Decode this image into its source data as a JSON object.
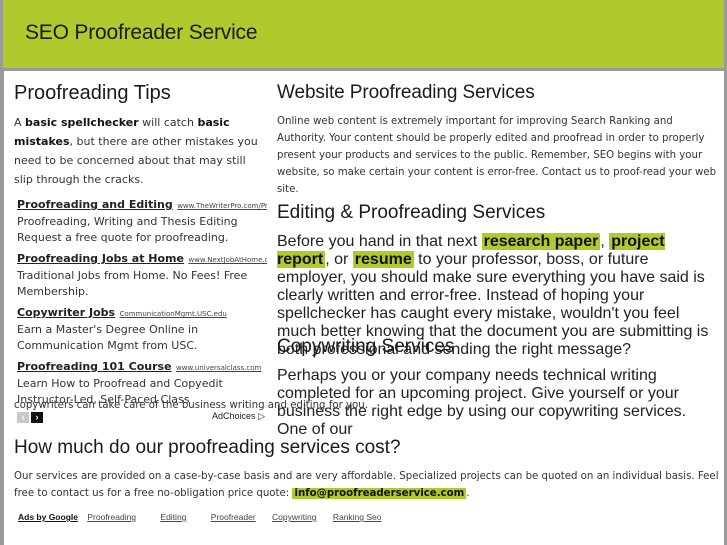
{
  "header": {
    "title": "SEO Proofreader Service"
  },
  "colors": {
    "accent": "#b0c92d",
    "frame": "#9a9a9a"
  },
  "sidebar": {
    "title": "Proofreading Tips",
    "intro": {
      "p1": "A ",
      "b1": "basic spellchecker",
      "p2": " will catch ",
      "b2": "basic mistakes",
      "p3": ", but there are other mistakes you need to be concerned about that may still slip through the cracks."
    },
    "ads": [
      {
        "title": "Proofreading and Editing",
        "url": "www.TheWriterPro.com/Proofreac",
        "desc": "Proofreading, Writing and Thesis Editing Request a free quote for proofreading."
      },
      {
        "title": "Proofreading Jobs at Home",
        "url": "www.NextJobAtHome.com/",
        "desc": "Traditional Jobs from Home. No Fees! Free Membership."
      },
      {
        "title": "Copywriter Jobs",
        "url": "CommunicationMgmt.USC.edu",
        "desc": "Earn a Master's Degree Online in Communication Mgmt from USC."
      },
      {
        "title": "Proofreading 101 Course",
        "url": "www.universalclass.com",
        "desc": "Learn How to Proofread and Copyedit Instructor-Led, Self-Paced Class"
      }
    ],
    "nav": {
      "prev_icon": "‹",
      "next_icon": "›",
      "adchoices": "AdChoices",
      "adchoices_icon": "▷"
    }
  },
  "sections": {
    "website": {
      "title": "Website Proofreading Services",
      "body": "Online web content is extremely important for improving Search Ranking and Authority. Your content should be properly edited and proofread in order to properly present your products and services to the public. Remember, SEO begins with your website, so make certain your content is error-free. Contact us to proof-read your web site."
    },
    "editing": {
      "title": "Editing & Proofreading Services",
      "t1": "Before you hand in that next ",
      "h1": "research paper",
      "t2": ", ",
      "h2": "project report",
      "t3": ", or ",
      "h3": "resume",
      "t4": " to your professor, boss, or future employer, you should make sure everything you have said is clearly written and error-free. Instead of hoping your spellchecker has caught every mistake, wouldn't you feel much better knowing that the document you are submitting is both professional and sending the right message?"
    },
    "copywriting": {
      "title": "Copywriting Services",
      "body": "Perhaps you or your company needs technical writing completed for an upcoming project. Give yourself or your business the right edge by using our copywriting services. One of our",
      "body_cont": "copywriters can take care of the business writing and editing for you."
    },
    "cost": {
      "title": "How much do our proofreading services cost?",
      "body": "Our services are provided on a case-by-case basis and are very affordable. Specialized projects can be quoted on an individual basis. Feel free to contact us for a free no-obligation price quote: ",
      "email": "info@proofreaderservice.com",
      "end": "."
    }
  },
  "google_ads": {
    "label": "Ads by Google",
    "links": [
      "Proofreading",
      "Editing",
      "Proofreader",
      "Copywriting",
      "Ranking Seo"
    ]
  }
}
